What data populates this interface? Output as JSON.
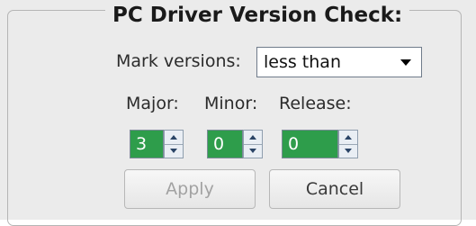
{
  "group": {
    "title": "PC Driver Version Check:"
  },
  "mark": {
    "label": "Mark versions:",
    "selected": "less than"
  },
  "fields": {
    "major_label": "Major:",
    "minor_label": "Minor:",
    "release_label": "Release:",
    "major_value": "3",
    "minor_value": "0",
    "release_value": "0"
  },
  "buttons": {
    "apply": "Apply",
    "cancel": "Cancel"
  },
  "colors": {
    "panel_bg": "#ebebeb",
    "field_green": "#2e9d4b"
  }
}
